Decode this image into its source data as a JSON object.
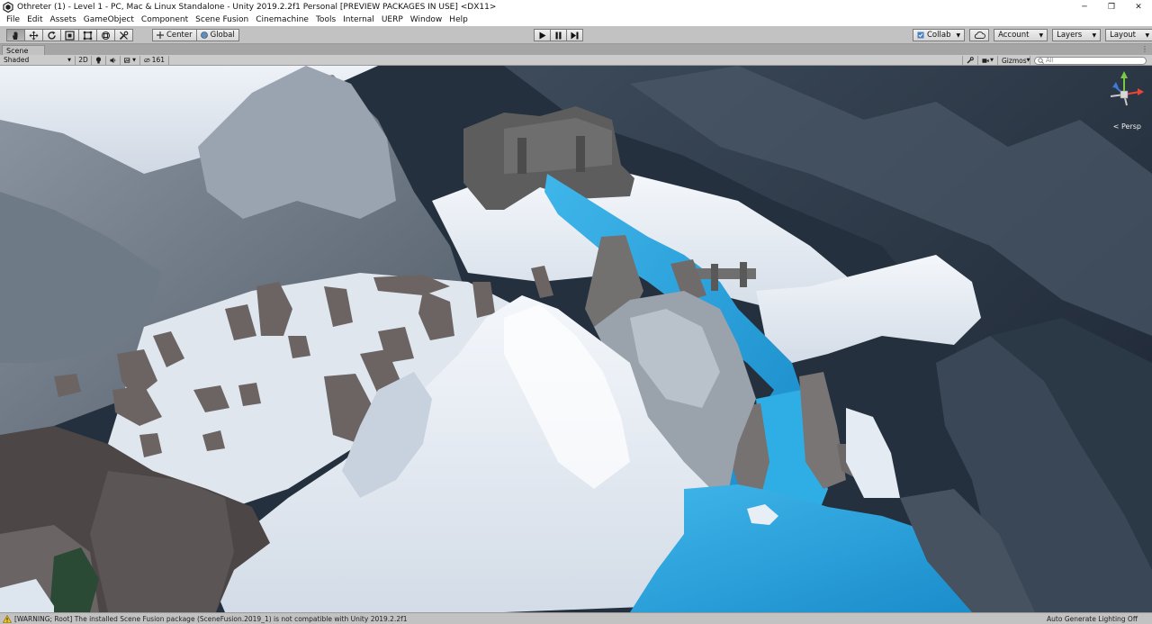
{
  "window": {
    "title": "Othreter (1) - Level 1 - PC, Mac & Linux Standalone - Unity 2019.2.2f1 Personal [PREVIEW PACKAGES IN USE] <DX11>",
    "minimize": "─",
    "maximize": "❐",
    "close": "✕"
  },
  "menu": [
    "File",
    "Edit",
    "Assets",
    "GameObject",
    "Component",
    "Scene Fusion",
    "Cinemachine",
    "Tools",
    "Internal",
    "UERP",
    "Window",
    "Help"
  ],
  "toolbar": {
    "pivot_label": "Center",
    "space_label": "Global",
    "collab_label": "Collab",
    "account_label": "Account",
    "layers_label": "Layers",
    "layout_label": "Layout"
  },
  "scene_tab": {
    "label": "Scene",
    "menu": "⋮"
  },
  "scene_toolbar": {
    "draw_mode": "Shaded",
    "mode_2d": "2D",
    "hidden_count": "161",
    "gizmos_label": "Gizmos",
    "search_placeholder": "All"
  },
  "viewport": {
    "projection_label": "< Persp"
  },
  "status": {
    "warning_text": "[WARNING; Root] The installed Scene Fusion package (SceneFusion.2019_1) is not compatible with Unity 2019.2.2f1",
    "lighting_text": "Auto Generate Lighting Off"
  },
  "colors": {
    "editor_bg": "#c2c2c2",
    "water": "#1f9fd8",
    "snow": "#e8eef5",
    "rock": "#6b6b6b"
  }
}
